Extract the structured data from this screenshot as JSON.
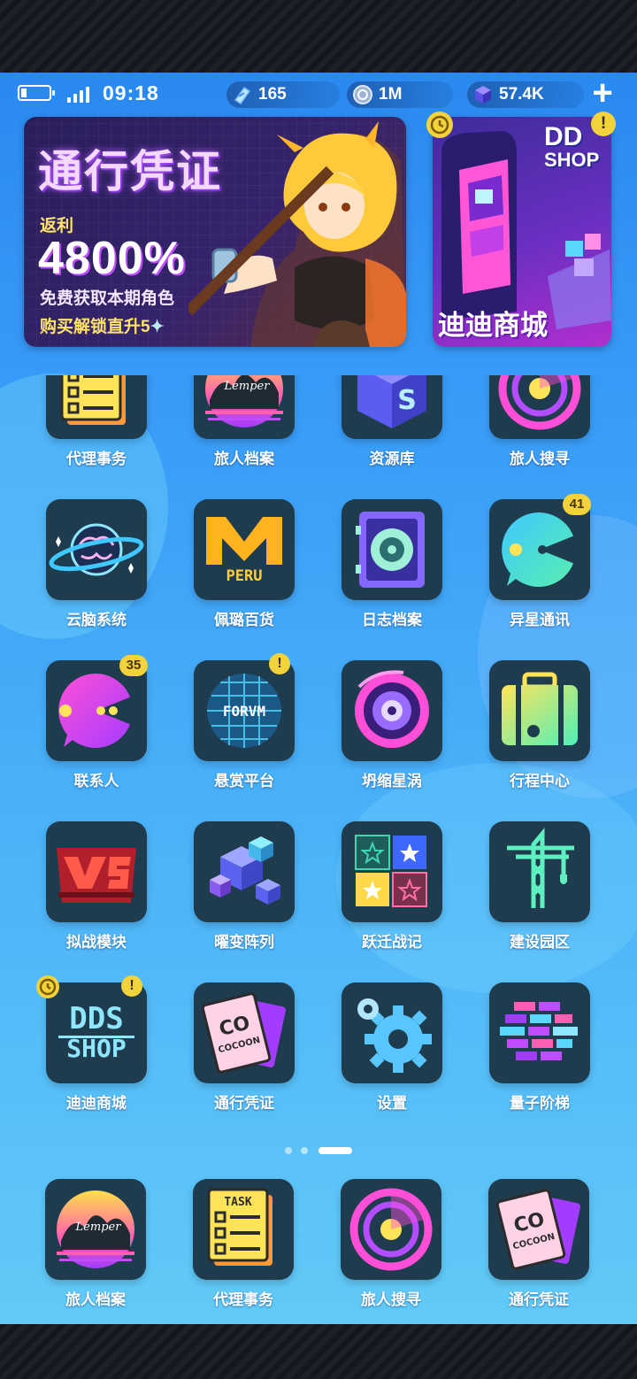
{
  "status": {
    "time": "09:18",
    "resources": [
      {
        "icon": "crystal-shard-icon",
        "value": "165"
      },
      {
        "icon": "coin-icon",
        "value": "1M"
      },
      {
        "icon": "cube-gem-icon",
        "value": "57.4K"
      }
    ],
    "add_label": "+"
  },
  "banners": {
    "pass": {
      "title": "通行凭证",
      "rebate": "返利",
      "percent": "4800%",
      "line1": "免费获取本期角色",
      "line2": "购买解锁直升5"
    },
    "shop": {
      "logo_top": "DD",
      "logo_bottom": "SHOP",
      "title": "迪迪商城",
      "warn": "!"
    }
  },
  "apps": [
    {
      "label": "代理事务",
      "icon": "task-list-icon"
    },
    {
      "label": "旅人档案",
      "icon": "lemper-archives-icon"
    },
    {
      "label": "资源库",
      "icon": "resource-cube-icon"
    },
    {
      "label": "旅人搜寻",
      "icon": "radar-icon"
    },
    {
      "label": "云脑系统",
      "icon": "brain-planet-icon"
    },
    {
      "label": "佩璐百货",
      "icon": "peru-logo-icon"
    },
    {
      "label": "日志档案",
      "icon": "log-disk-icon"
    },
    {
      "label": "异星通讯",
      "icon": "chat-pacman-icon",
      "count": "41"
    },
    {
      "label": "联系人",
      "icon": "contact-pacman-icon",
      "count": "35"
    },
    {
      "label": "悬赏平台",
      "icon": "forum-disco-icon",
      "warn": "!",
      "text": "FORVM"
    },
    {
      "label": "坍缩星涡",
      "icon": "vortex-icon"
    },
    {
      "label": "行程中心",
      "icon": "suitcase-icon"
    },
    {
      "label": "拟战模块",
      "icon": "vs-module-icon"
    },
    {
      "label": "曜变阵列",
      "icon": "cube-array-icon"
    },
    {
      "label": "跃迁战记",
      "icon": "star-grid-icon"
    },
    {
      "label": "建设园区",
      "icon": "crane-icon"
    },
    {
      "label": "迪迪商城",
      "icon": "ddshop-icon",
      "warn": "!"
    },
    {
      "label": "通行凭证",
      "icon": "cocoon-pass-icon"
    },
    {
      "label": "设置",
      "icon": "gear-icon"
    },
    {
      "label": "量子阶梯",
      "icon": "quantum-bricks-icon"
    }
  ],
  "dock": [
    {
      "label": "旅人档案",
      "icon": "lemper-archives-icon"
    },
    {
      "label": "代理事务",
      "icon": "task-list-icon",
      "text": "TASK"
    },
    {
      "label": "旅人搜寻",
      "icon": "radar-icon"
    },
    {
      "label": "通行凭证",
      "icon": "cocoon-pass-icon"
    }
  ],
  "pager": {
    "total": 3,
    "active": 3
  }
}
